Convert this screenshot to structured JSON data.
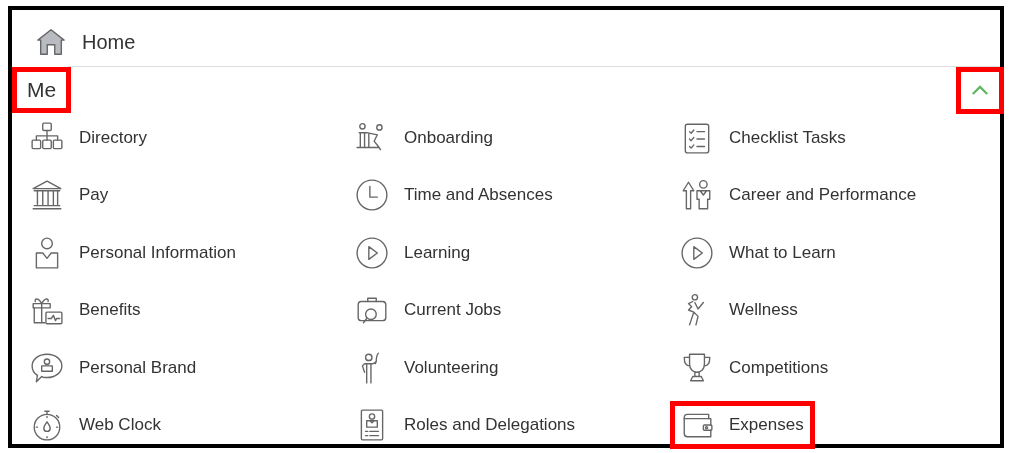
{
  "home": {
    "label": "Home"
  },
  "section": {
    "title": "Me",
    "highlighted": true,
    "expanded": true,
    "toggle_highlighted": true
  },
  "items": [
    {
      "label": "Directory",
      "highlighted": false
    },
    {
      "label": "Onboarding",
      "highlighted": false
    },
    {
      "label": "Checklist Tasks",
      "highlighted": false
    },
    {
      "label": "Pay",
      "highlighted": false
    },
    {
      "label": "Time and Absences",
      "highlighted": false
    },
    {
      "label": "Career and Performance",
      "highlighted": false
    },
    {
      "label": "Personal Information",
      "highlighted": false
    },
    {
      "label": "Learning",
      "highlighted": false
    },
    {
      "label": "What to Learn",
      "highlighted": false
    },
    {
      "label": "Benefits",
      "highlighted": false
    },
    {
      "label": "Current Jobs",
      "highlighted": false
    },
    {
      "label": "Wellness",
      "highlighted": false
    },
    {
      "label": "Personal Brand",
      "highlighted": false
    },
    {
      "label": "Volunteering",
      "highlighted": false
    },
    {
      "label": "Competitions",
      "highlighted": false
    },
    {
      "label": "Web Clock",
      "highlighted": false
    },
    {
      "label": "Roles and Delegations",
      "highlighted": false
    },
    {
      "label": "Expenses",
      "highlighted": true
    }
  ]
}
